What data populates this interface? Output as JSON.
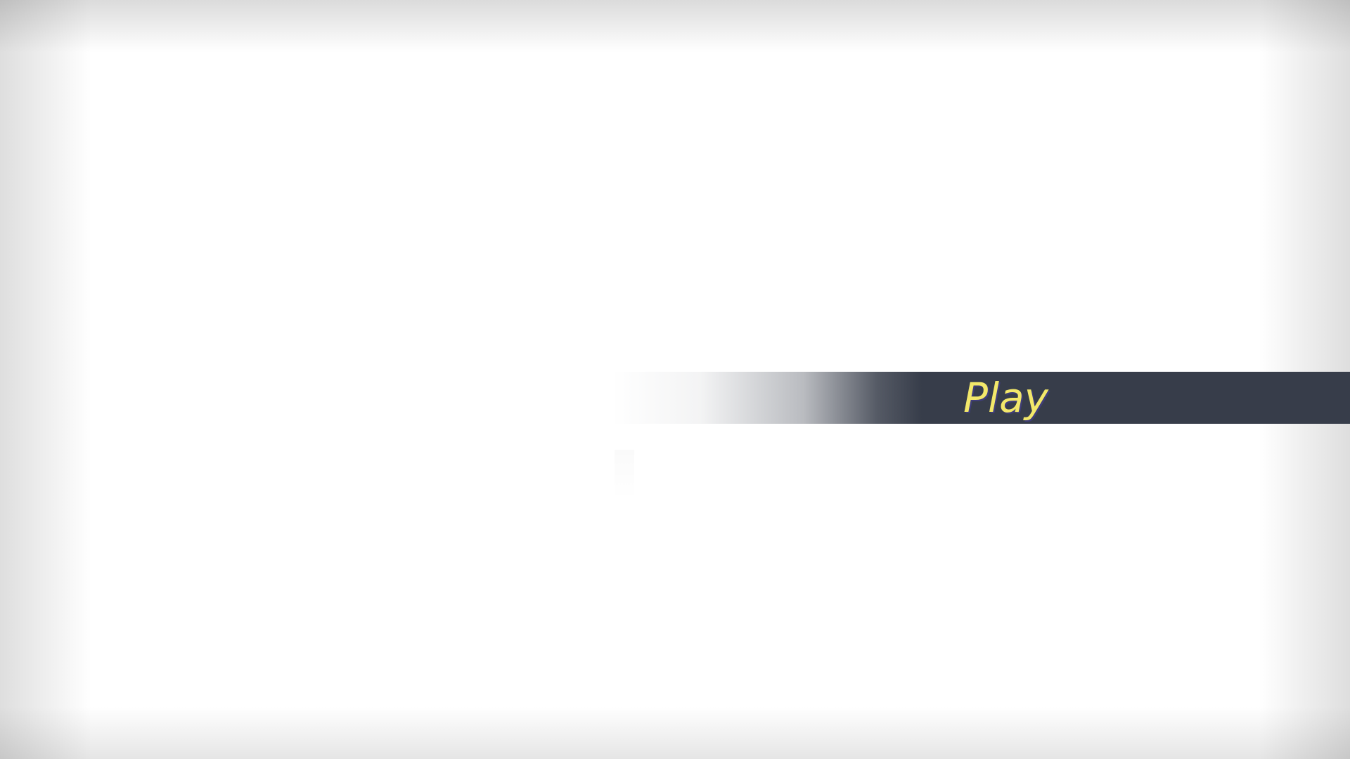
{
  "main_menu": {
    "items": [
      {
        "label": "Play",
        "selected": true
      }
    ]
  },
  "colors": {
    "background": "#ffffff",
    "bar": "#373d4a",
    "label_text": "#f3e86a",
    "label_shadow": "#3f3d7a"
  }
}
